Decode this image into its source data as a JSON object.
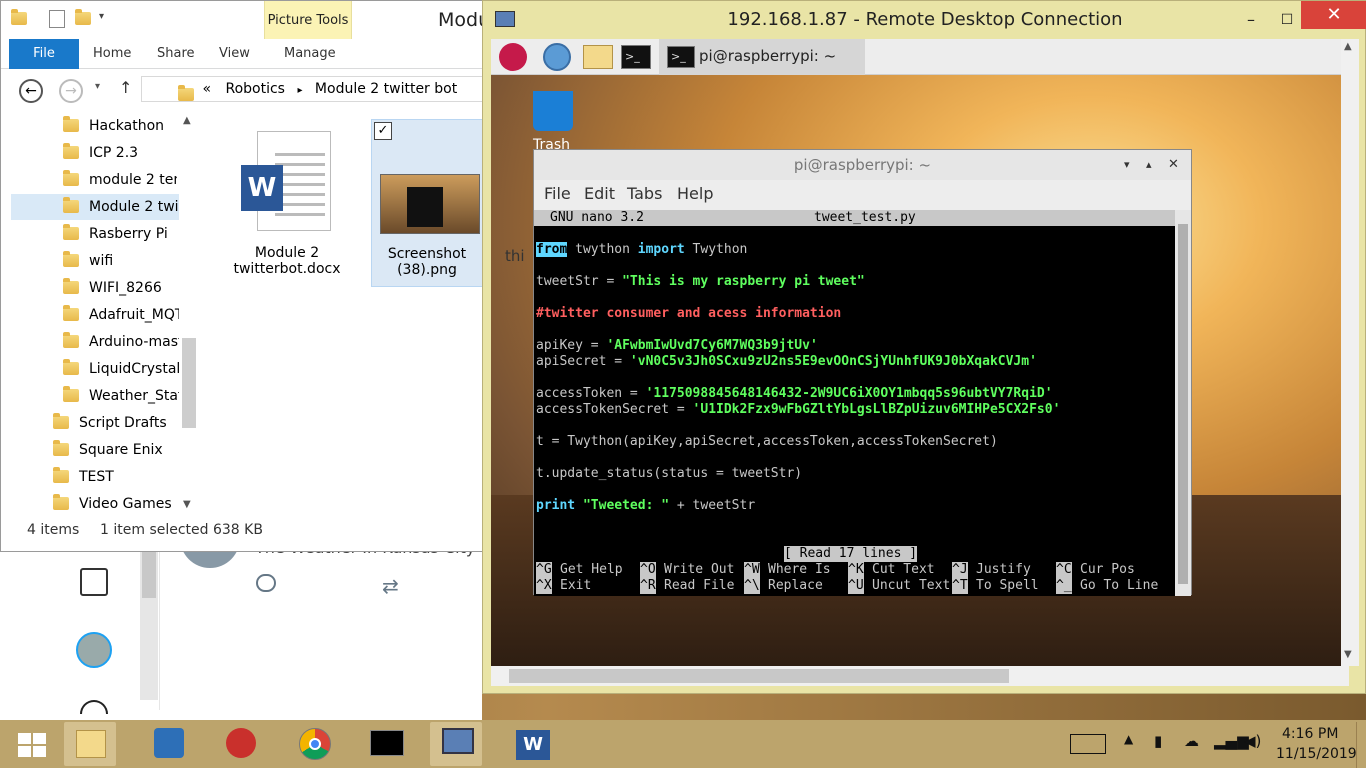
{
  "explorer": {
    "window_title": "Modu",
    "ribbon_context_label": "Picture Tools",
    "tabs": [
      "File",
      "Home",
      "Share",
      "View",
      "Manage"
    ],
    "breadcrumb_prefix": "«",
    "breadcrumb": [
      "Robotics",
      "Module 2 twitter bot"
    ],
    "nav_items": [
      "Hackathon",
      "ICP 2.3",
      "module 2 ten",
      "Module 2 twi",
      "Rasberry Pi",
      "wifi",
      "WIFI_8266",
      "Adafruit_MQT",
      "Arduino-mast",
      "LiquidCrystal_",
      "Weather_Stat",
      "Script Drafts",
      "Square Enix",
      "TEST",
      "Video Games"
    ],
    "files": [
      {
        "name_line1": "Module 2",
        "name_line2": "twitterbot.docx",
        "icon": "word-doc-icon"
      },
      {
        "name_line1": "Screenshot",
        "name_line2": "(38).png",
        "icon": "image-thumbnail"
      }
    ],
    "status_items": "4 items",
    "status_selected": "1 item selected  638 KB"
  },
  "background_page": {
    "partial_text": "The Weather In Kansas City"
  },
  "rdp": {
    "title": "192.168.1.87 - Remote Desktop Connection",
    "panel_task": "pi@raspberrypi: ~",
    "trash_label": "Trash",
    "desktop_partial": "thi"
  },
  "terminal": {
    "title": "pi@raspberrypi: ~",
    "menu": [
      "File",
      "Edit",
      "Tabs",
      "Help"
    ],
    "nano_version": "GNU nano 3.2",
    "filename": "tweet_test.py",
    "lines": {
      "l1_kw1": "from",
      "l1_mid": " twython ",
      "l1_kw2": "import",
      "l1_end": " Twython",
      "l2_a": "tweetStr = ",
      "l2_s": "\"This is my raspberry pi tweet\"",
      "l3_c": "#twitter consumer and acess information",
      "l4_a": "apiKey = ",
      "l4_s": "'AFwbmIwUvd7Cy6M7WQ3b9jtUv'",
      "l5_a": "apiSecret = ",
      "l5_s": "'vN0C5v3Jh0SCxu9zU2ns5E9evOOnCSjYUnhfUK9J0bXqakCVJm'",
      "l6_a": "accessToken = ",
      "l6_s": "'1175098845648146432-2W9UC6iX0OY1mbqq5s96ubtVY7RqiD'",
      "l7_a": "accessTokenSecret = ",
      "l7_s": "'U1IDk2Fzx9wFbGZltYbLgsLlBZpUizuv6MIHPe5CX2Fs0'",
      "l8": "t = Twython(apiKey,apiSecret,accessToken,accessTokenSecret)",
      "l9": "t.update_status(status = tweetStr)",
      "l10_kw": "print",
      "l10_s": " \"Tweeted: \"",
      "l10_end": " + tweetStr"
    },
    "status_msg": "[ Read 17 lines ]",
    "shortcuts_row1": [
      [
        "^G",
        "Get Help"
      ],
      [
        "^O",
        "Write Out"
      ],
      [
        "^W",
        "Where Is"
      ],
      [
        "^K",
        "Cut Text"
      ],
      [
        "^J",
        "Justify"
      ],
      [
        "^C",
        "Cur Pos"
      ]
    ],
    "shortcuts_row2": [
      [
        "^X",
        "Exit"
      ],
      [
        "^R",
        "Read File"
      ],
      [
        "^\\",
        "Replace"
      ],
      [
        "^U",
        "Uncut Text"
      ],
      [
        "^T",
        "To Spell"
      ],
      [
        "^_",
        "Go To Line"
      ]
    ]
  },
  "taskbar": {
    "time": "4:16 PM",
    "date": "11/15/2019"
  }
}
